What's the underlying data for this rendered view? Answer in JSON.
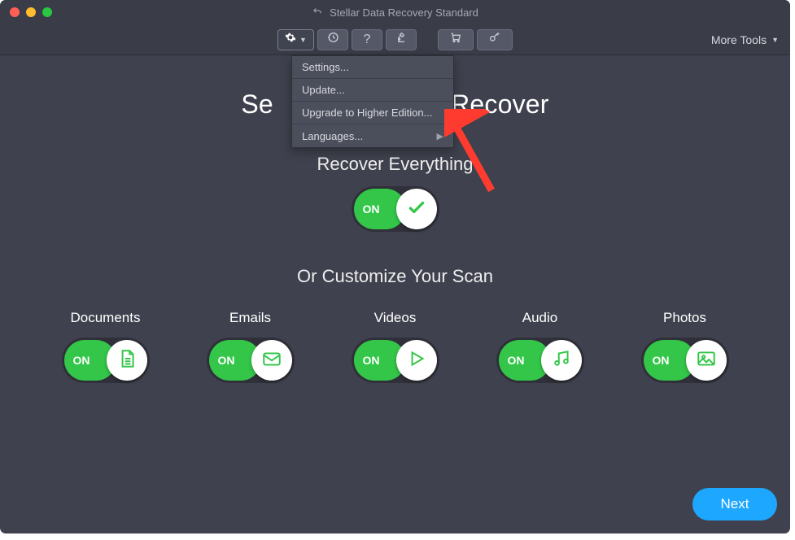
{
  "titlebar": {
    "app_title": "Stellar Data Recovery Standard"
  },
  "toolbar": {
    "more_tools": "More Tools"
  },
  "dropdown": {
    "items": [
      {
        "label": "Settings..."
      },
      {
        "label": "Update..."
      },
      {
        "label": "Upgrade to Higher Edition..."
      },
      {
        "label": "Languages..."
      }
    ]
  },
  "main": {
    "heading_left": "Se",
    "heading_right": "Recover",
    "recover_everything": "Recover Everything",
    "toggle_on": "ON",
    "or_customize": "Or Customize Your Scan"
  },
  "categories": [
    {
      "label": "Documents",
      "icon": "document"
    },
    {
      "label": "Emails",
      "icon": "email"
    },
    {
      "label": "Videos",
      "icon": "video"
    },
    {
      "label": "Audio",
      "icon": "audio"
    },
    {
      "label": "Photos",
      "icon": "photo"
    }
  ],
  "buttons": {
    "next": "Next"
  }
}
